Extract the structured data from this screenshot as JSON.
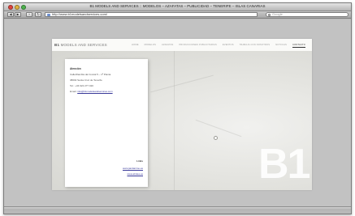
{
  "window": {
    "title": "B1 MODELS AND SERVICES :: MODELOS – AZAFATAS – PUBLICIDAD – TENERIFE – ISLAS CANARIAS"
  },
  "toolbar": {
    "back_glyph": "◀",
    "forward_glyph": "▶",
    "add_glyph": "+",
    "reload_glyph": "↻",
    "url": "http://www.b1modelsandservices.com/",
    "search_placeholder": "Google"
  },
  "site": {
    "logo_mark": "B1",
    "logo_text": "MODELS AND SERVICES",
    "nav": [
      {
        "label": "HOME"
      },
      {
        "label": "MODELOS"
      },
      {
        "label": "AZAFATAS"
      },
      {
        "label": "PRODUCCIONES PUBLICITARIAS"
      },
      {
        "label": "EVENTOS"
      },
      {
        "label": "TRABAJA CON NOSOTROS"
      },
      {
        "label": "NOTICIAS"
      },
      {
        "label": "CONTACTO",
        "active": true
      }
    ]
  },
  "contact": {
    "heading": "Atención",
    "address_1": "Calle/Rambla del Juncal 5 – 1ª Planta",
    "address_2": "38002 Santa Cruz de Tenerife",
    "phone": "Tel.: +34 922 277 020",
    "email_label": "Email:",
    "email": "info@b1modelsandservices.com",
    "links_label": "Links",
    "link_1": "www.jandanime.es",
    "link_2": "www.ahdea.es"
  },
  "watermark": "B1",
  "colors": {
    "chrome": "#b9b9b9",
    "page_bg": "#fafaf8",
    "active_nav": "#333333",
    "link": "#3a3a9a"
  }
}
